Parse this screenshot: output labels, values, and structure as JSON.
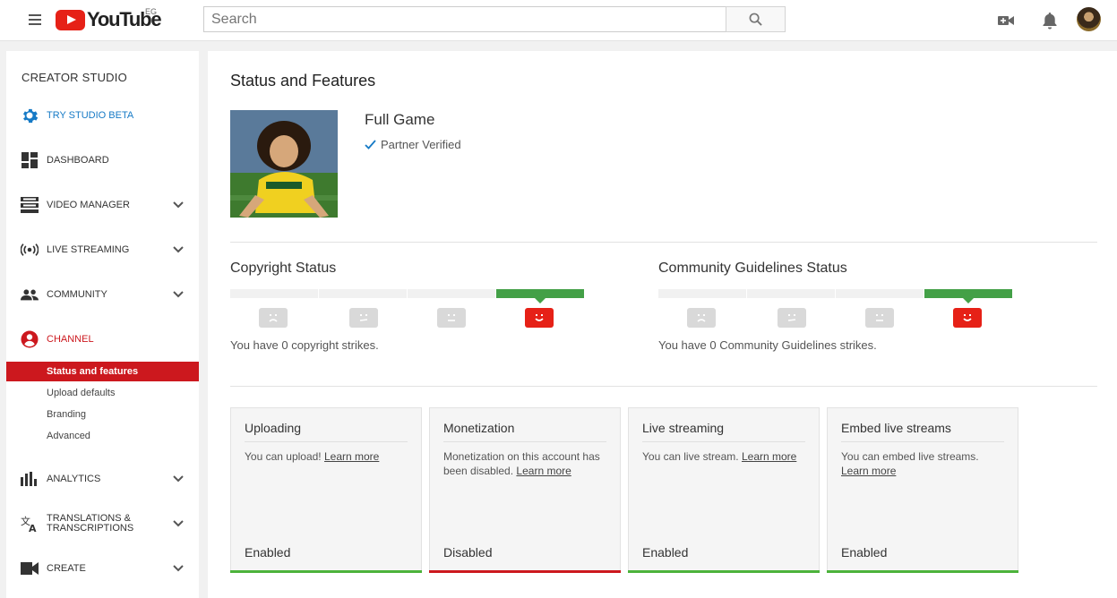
{
  "header": {
    "logo_text": "YouTube",
    "region": "EG",
    "search_placeholder": "Search"
  },
  "sidebar": {
    "title": "CREATOR STUDIO",
    "items": [
      {
        "label": "TRY STUDIO BETA",
        "icon": "gear-icon",
        "color": "#167ac6"
      },
      {
        "label": "DASHBOARD",
        "icon": "dashboard-icon"
      },
      {
        "label": "VIDEO MANAGER",
        "icon": "video-manager-icon"
      },
      {
        "label": "LIVE STREAMING",
        "icon": "live-streaming-icon"
      },
      {
        "label": "COMMUNITY",
        "icon": "community-icon"
      },
      {
        "label": "CHANNEL",
        "icon": "channel-icon",
        "color": "#cc181e"
      },
      {
        "label": "ANALYTICS",
        "icon": "analytics-icon"
      },
      {
        "label": "TRANSLATIONS &",
        "label2": "TRANSCRIPTIONS",
        "icon": "translate-icon"
      },
      {
        "label": "CREATE",
        "icon": "create-icon"
      }
    ],
    "channel_sub": [
      "Status and features",
      "Upload defaults",
      "Branding",
      "Advanced"
    ]
  },
  "main": {
    "title": "Status and Features",
    "channel_name": "Full Game",
    "verified_label": "Partner Verified",
    "copyright": {
      "title": "Copyright Status",
      "text": "You have 0 copyright strikes."
    },
    "community": {
      "title": "Community Guidelines Status",
      "text": "You have 0 Community Guidelines strikes."
    },
    "cards": [
      {
        "title": "Uploading",
        "desc": "You can upload!",
        "link": "Learn more",
        "status": "Enabled",
        "color": "#4cb33b"
      },
      {
        "title": "Monetization",
        "desc": "Monetization on this account has been disabled.",
        "link": "Learn more",
        "status": "Disabled",
        "color": "#cc181e"
      },
      {
        "title": "Live streaming",
        "desc": "You can live stream.",
        "link": "Learn more",
        "status": "Enabled",
        "color": "#4cb33b"
      },
      {
        "title": "Embed live streams",
        "desc": "You can embed live streams.",
        "link": "Learn more",
        "status": "Enabled",
        "color": "#4cb33b"
      }
    ]
  },
  "colors": {
    "accent_red": "#cc181e",
    "strike_green": "#43a047",
    "link_blue": "#167ac6"
  }
}
